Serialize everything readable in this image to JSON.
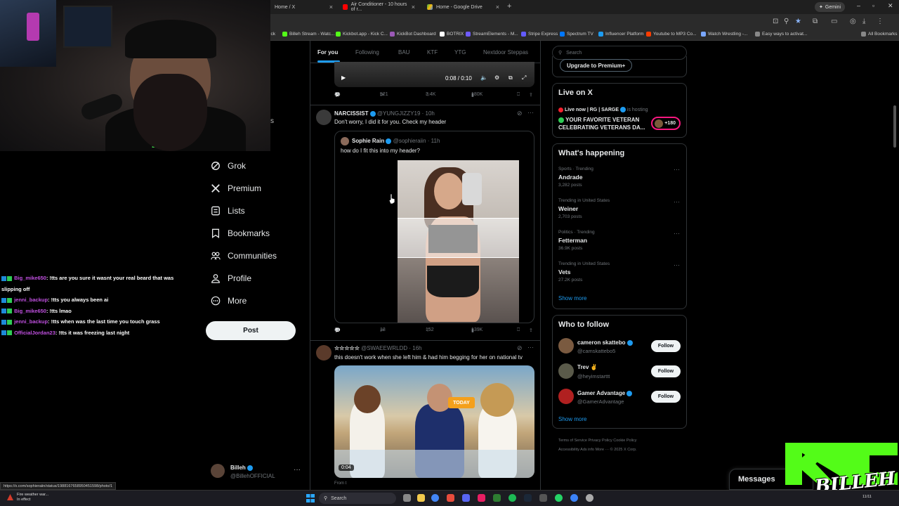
{
  "browser": {
    "tabs": [
      {
        "label": "Home / X"
      },
      {
        "label": "Air Conditioner - 10 hours of r..."
      },
      {
        "label": "Home - Google Drive"
      }
    ],
    "gemini_label": "Gemini",
    "bookmarks": [
      "Billeh Stream - Watc...",
      "Kickbot.app - Kick C...",
      "KickBot Dashboard",
      "BOTRIX",
      "StreamElements - M...",
      "Stripe Express",
      "Spectrum TV",
      "Influencer Platform",
      "Youtube to MP3 Co...",
      "Watch Wrestling -...",
      "Easy ways to activat...",
      "All Bookmarks"
    ],
    "colors": {
      "accent": "#1d9bf0",
      "kick_green": "#53fc18",
      "live_red": "#f4212e"
    }
  },
  "left_nav": {
    "items": [
      {
        "label": "Grok",
        "icon": "grok-icon"
      },
      {
        "label": "Premium",
        "icon": "x-logo-icon"
      },
      {
        "label": "Lists",
        "icon": "list-icon"
      },
      {
        "label": "Bookmarks",
        "icon": "bookmark-icon"
      },
      {
        "label": "Communities",
        "icon": "communities-icon"
      },
      {
        "label": "Profile",
        "icon": "profile-icon"
      },
      {
        "label": "More",
        "icon": "more-circle-icon"
      }
    ],
    "post_label": "Post",
    "account": {
      "name": "Billeh",
      "handle": "@BillehOFFICIAL"
    },
    "cut_letter": "s"
  },
  "chat": [
    {
      "user": "Big_mike650",
      "text": ": !tts are you sure it wasnt your real beard that was slipping off"
    },
    {
      "user": "jenni_backup",
      "text": ": !tts you always been ai"
    },
    {
      "user": "Big_mike650",
      "text": ": !tts lmao"
    },
    {
      "user": "jenni_backup",
      "text": ": !tts when was the last time you touch grass"
    },
    {
      "user": "OfficialJordan23",
      "text": ": !tts it was freezing last night"
    }
  ],
  "feed": {
    "tabs": [
      "For you",
      "Following",
      "BAU",
      "KTF",
      "YTG",
      "Nextdoor Steppas"
    ],
    "video_top": {
      "time": "0:08 / 0:10"
    },
    "post1_actions": {
      "replies": "16",
      "reposts": "521",
      "likes": "3.4K",
      "views": "180K"
    },
    "post2": {
      "name": "NARCISSIST",
      "handle": "@YUNGJIZZY19",
      "time": "· 10h",
      "text": "Don't worry, I did it for you. Check my header",
      "quote": {
        "name": "Sophie Rain",
        "handle": "@sophieraiin",
        "time": "· 11h",
        "text": "how do I fit this into my header?"
      },
      "actions": {
        "replies": "11",
        "reposts": "13",
        "likes": "152",
        "views": "139K"
      }
    },
    "post3": {
      "name": "☆☆☆☆☆",
      "handle": "@SWAEEWRLDD",
      "time": "· 16h",
      "text": "this doesn't work when she left him & had him begging for her on national tv",
      "video_duration": "0:04",
      "video_badge": "TODAY",
      "from_label": "From t"
    }
  },
  "right": {
    "search_placeholder": "Search",
    "upgrade_label": "Upgrade to Premium+",
    "live": {
      "title": "Live on X",
      "host_line": "Live now | RG | SARGE",
      "hosting": "is hosting",
      "stream_title_1": "YOUR FAVORITE VETERAN",
      "stream_title_2": "CELEBRATING VETERANS DA...",
      "count": "+180"
    },
    "whats_happening": {
      "title": "What's happening",
      "trends": [
        {
          "meta": "Sports · Trending",
          "name": "Andrade",
          "posts": "3,282 posts"
        },
        {
          "meta": "Trending in United States",
          "name": "Weiner",
          "posts": "2,703 posts"
        },
        {
          "meta": "Politics · Trending",
          "name": "Fetterman",
          "posts": "36.9K posts"
        },
        {
          "meta": "Trending in United States",
          "name": "Vets",
          "posts": "27.2K posts"
        }
      ],
      "show_more": "Show more"
    },
    "who_to_follow": {
      "title": "Who to follow",
      "accounts": [
        {
          "name": "cameron skattebo",
          "handle": "@camskattebo5",
          "button": "Follow"
        },
        {
          "name": "Trev ✌️",
          "handle": "@heyimstarttt",
          "button": "Follow"
        },
        {
          "name": "Gamer Advantage",
          "handle": "@GamerAdvantage",
          "button": "Follow"
        }
      ],
      "show_more": "Show more"
    },
    "footer": {
      "line1": "Terms of Service    Privacy Policy    Cookie Policy",
      "line2": "Accessibility    Ads info    More ···    © 2025 X Corp."
    }
  },
  "overlays": {
    "messages_label": "Messages",
    "brand_tag": "BILLEH",
    "status_url": "https://x.com/sophieraiin/status/1988167658950451598/photo/1"
  },
  "taskbar": {
    "weather_line1": "Fire weather war...",
    "weather_line2": "In effect",
    "search_label": "Search",
    "clock": "11/11"
  }
}
